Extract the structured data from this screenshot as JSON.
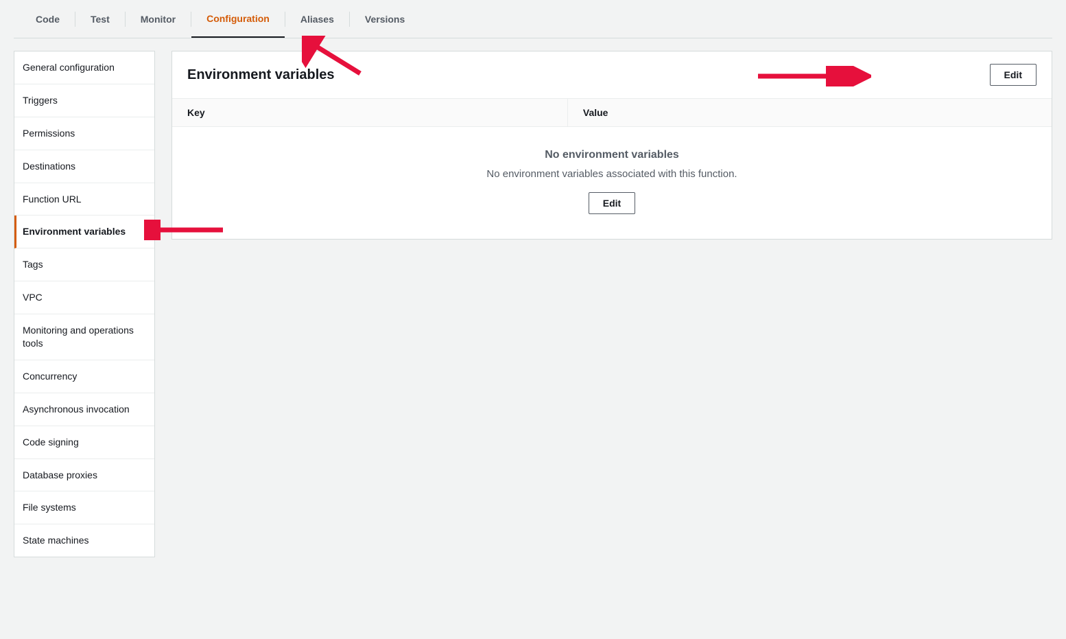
{
  "tabs": {
    "code": "Code",
    "test": "Test",
    "monitor": "Monitor",
    "configuration": "Configuration",
    "aliases": "Aliases",
    "versions": "Versions",
    "active": "configuration"
  },
  "sidebar": {
    "items": [
      "General configuration",
      "Triggers",
      "Permissions",
      "Destinations",
      "Function URL",
      "Environment variables",
      "Tags",
      "VPC",
      "Monitoring and operations tools",
      "Concurrency",
      "Asynchronous invocation",
      "Code signing",
      "Database proxies",
      "File systems",
      "State machines"
    ],
    "active_index": 5
  },
  "panel": {
    "title": "Environment variables",
    "edit_label": "Edit",
    "columns": {
      "key": "Key",
      "value": "Value"
    },
    "empty_title": "No environment variables",
    "empty_desc": "No environment variables associated with this function.",
    "empty_action": "Edit"
  },
  "colors": {
    "accent": "#d45b07",
    "text_muted": "#545b64",
    "border": "#d5dbdb",
    "arrow": "#e6103c"
  }
}
